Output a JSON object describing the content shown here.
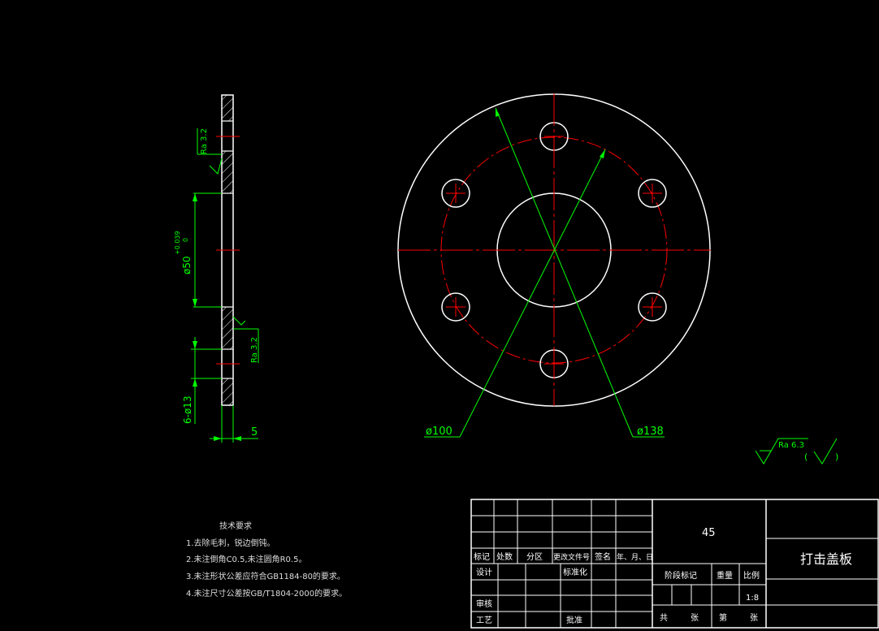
{
  "colors": {
    "background": "#000000",
    "outline": "#ffffff",
    "centerline": "#ff0000",
    "dimension": "#00ff00",
    "tech_text": "#dddddd"
  },
  "section_view": {
    "roughness_top": "Ra 3.2",
    "roughness_bottom": "Ra 3.2",
    "dim_bore": "ø50",
    "dim_bore_tol": "+0.039",
    "dim_bore_tol2": "0",
    "dim_holes": "6-ø13",
    "dim_thickness": "5"
  },
  "plan_view": {
    "dim_pcd": "ø100",
    "dim_outer": "ø138"
  },
  "general_roughness": {
    "value": "Ra 6.3",
    "paren_open": "(",
    "paren_close": ")"
  },
  "tech_requirements": {
    "title": "技术要求",
    "items": [
      "1.去除毛刺，锐边倒钝。",
      "2.未注倒角C0.5,未注圆角R0.5。",
      "3.未注形状公差应符合GB1184-80的要求。",
      "4.未注尺寸公差按GB/T1804-2000的要求。"
    ]
  },
  "title_block": {
    "material": "45",
    "part_name": "打击盖板",
    "rev_headers": [
      "标记",
      "处数",
      "分区",
      "更改文件号",
      "签名",
      "年、月、日"
    ],
    "design": "设计",
    "standardization": "标准化",
    "review": "审核",
    "process": "工艺",
    "approve": "批准",
    "stage_mark": "阶段标记",
    "weight": "重量",
    "scale": "比例",
    "scale_value": "1:8",
    "sheets_total": "共",
    "sheets_unit1": "张",
    "sheet_no": "第",
    "sheets_unit2": "张"
  }
}
